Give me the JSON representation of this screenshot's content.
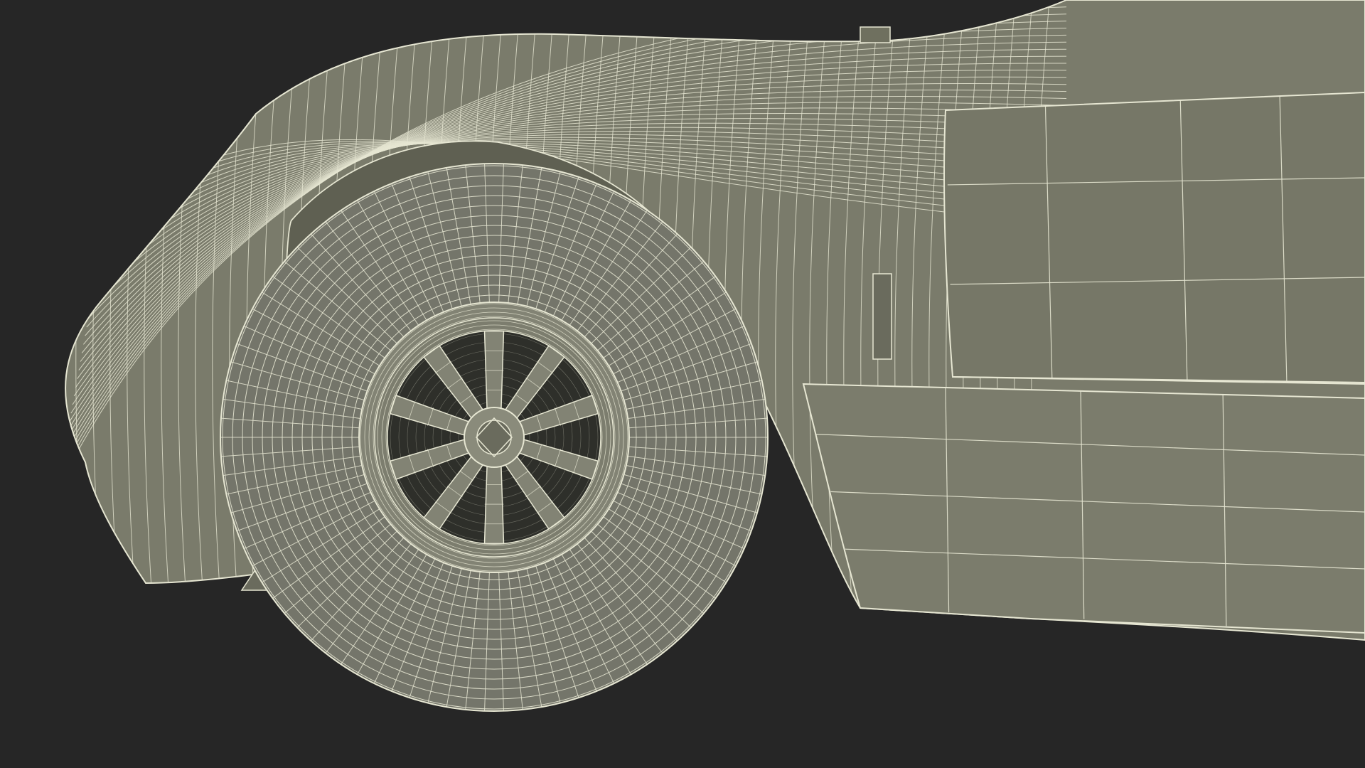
{
  "scene": {
    "subject": "wireframe-car-front-wheel",
    "colors": {
      "background": "#262626",
      "body_fill": "#7a7b6b",
      "body_shade": "#5f6052",
      "tire_fill": "#74756a",
      "rim_fill": "#828374",
      "dark_fill": "#2e2f2a",
      "wire": "#e6e6d2"
    },
    "wheel": {
      "spoke_count": 10
    }
  }
}
